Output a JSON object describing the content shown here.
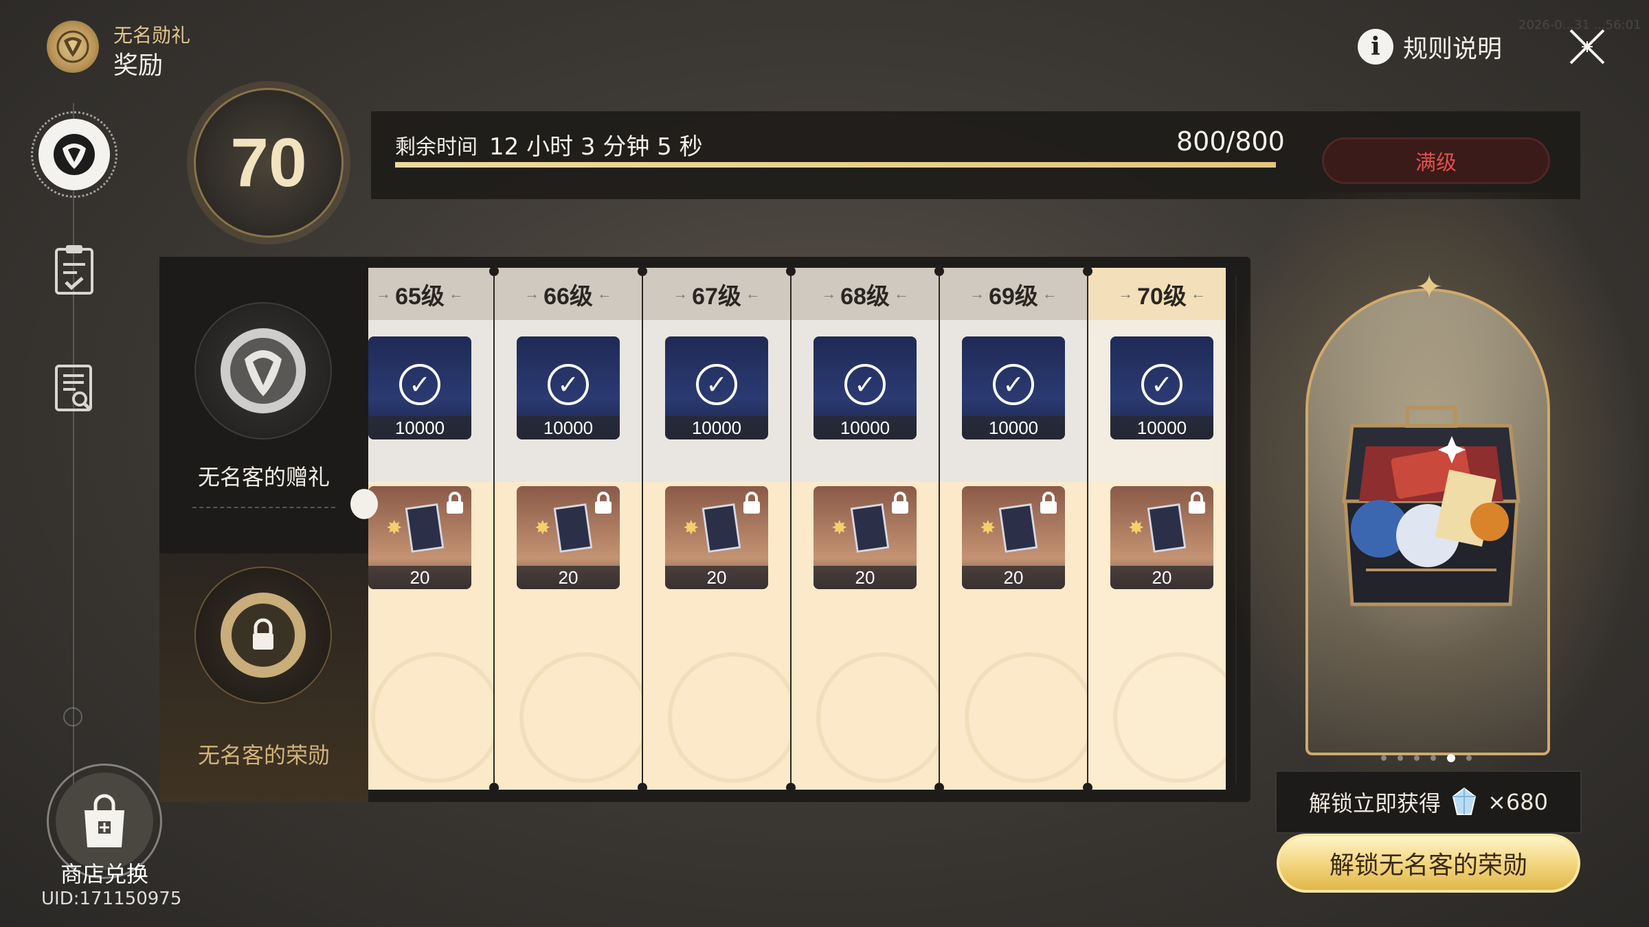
{
  "header": {
    "subtitle": "无名勋礼",
    "title": "奖励"
  },
  "top": {
    "rules_label": "规则说明",
    "timestamp": "2026-0...31 ...56:01"
  },
  "level": {
    "current": "70",
    "remaining_label": "剩余时间",
    "remaining_time": "12 小时 3 分钟 5 秒",
    "exp_text": "800/800",
    "exp_progress": 1.0,
    "max_label": "满级"
  },
  "tracks": {
    "free_label": "无名客的赠礼",
    "premium_label": "无名客的荣勋"
  },
  "levels": [
    {
      "label": "65级",
      "free_qty": "10000",
      "premium_qty": "20"
    },
    {
      "label": "66级",
      "free_qty": "10000",
      "premium_qty": "20"
    },
    {
      "label": "67级",
      "free_qty": "10000",
      "premium_qty": "20"
    },
    {
      "label": "68级",
      "free_qty": "10000",
      "premium_qty": "20"
    },
    {
      "label": "69级",
      "free_qty": "10000",
      "premium_qty": "20"
    },
    {
      "label": "70级",
      "free_qty": "10000",
      "premium_qty": "20"
    }
  ],
  "unlock": {
    "info_text": "解锁立即获得",
    "gem_count": "×680",
    "button_label": "解锁无名客的荣勋",
    "carousel_total": 6,
    "carousel_active": 5
  },
  "sidebar": {
    "shop_label": "商店兑换",
    "uid": "UID:171150975"
  },
  "colors": {
    "accent": "#e6c57a",
    "maxed_red": "#e0504a",
    "panel": "#1e1c1a"
  }
}
